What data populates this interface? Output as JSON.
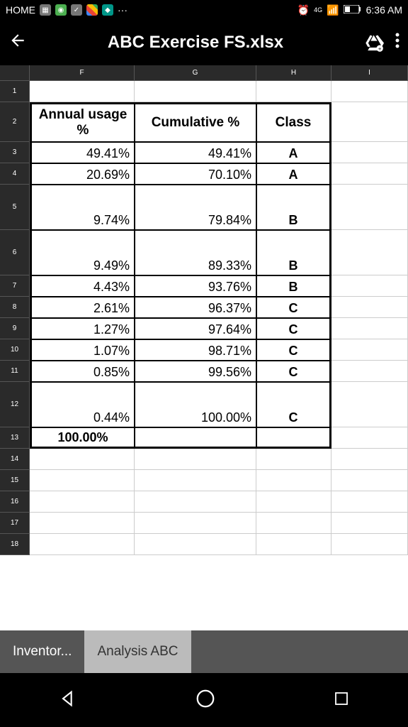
{
  "status": {
    "home": "HOME",
    "network": "4G LTE",
    "time": "6:36 AM"
  },
  "appbar": {
    "title": "ABC Exercise FS.xlsx"
  },
  "columns": [
    "F",
    "G",
    "H",
    "I"
  ],
  "row_numbers": [
    "1",
    "2",
    "3",
    "4",
    "5",
    "6",
    "7",
    "8",
    "9",
    "10",
    "11",
    "12",
    "13",
    "14",
    "15",
    "16",
    "17",
    "18"
  ],
  "headers": {
    "F": "Annual usage %",
    "G": "Cumulative %",
    "H": "Class"
  },
  "rows": [
    {
      "F": "49.41%",
      "G": "49.41%",
      "H": "A"
    },
    {
      "F": "20.69%",
      "G": "70.10%",
      "H": "A"
    },
    {
      "F": "9.74%",
      "G": "79.84%",
      "H": "B"
    },
    {
      "F": "9.49%",
      "G": "89.33%",
      "H": "B"
    },
    {
      "F": "4.43%",
      "G": "93.76%",
      "H": "B"
    },
    {
      "F": "2.61%",
      "G": "96.37%",
      "H": "C"
    },
    {
      "F": "1.27%",
      "G": "97.64%",
      "H": "C"
    },
    {
      "F": "1.07%",
      "G": "98.71%",
      "H": "C"
    },
    {
      "F": "0.85%",
      "G": "99.56%",
      "H": "C"
    },
    {
      "F": "0.44%",
      "G": "100.00%",
      "H": "C"
    }
  ],
  "total": {
    "F": "100.00%"
  },
  "tabs": {
    "left": "Inventor...",
    "active": "Analysis ABC"
  }
}
